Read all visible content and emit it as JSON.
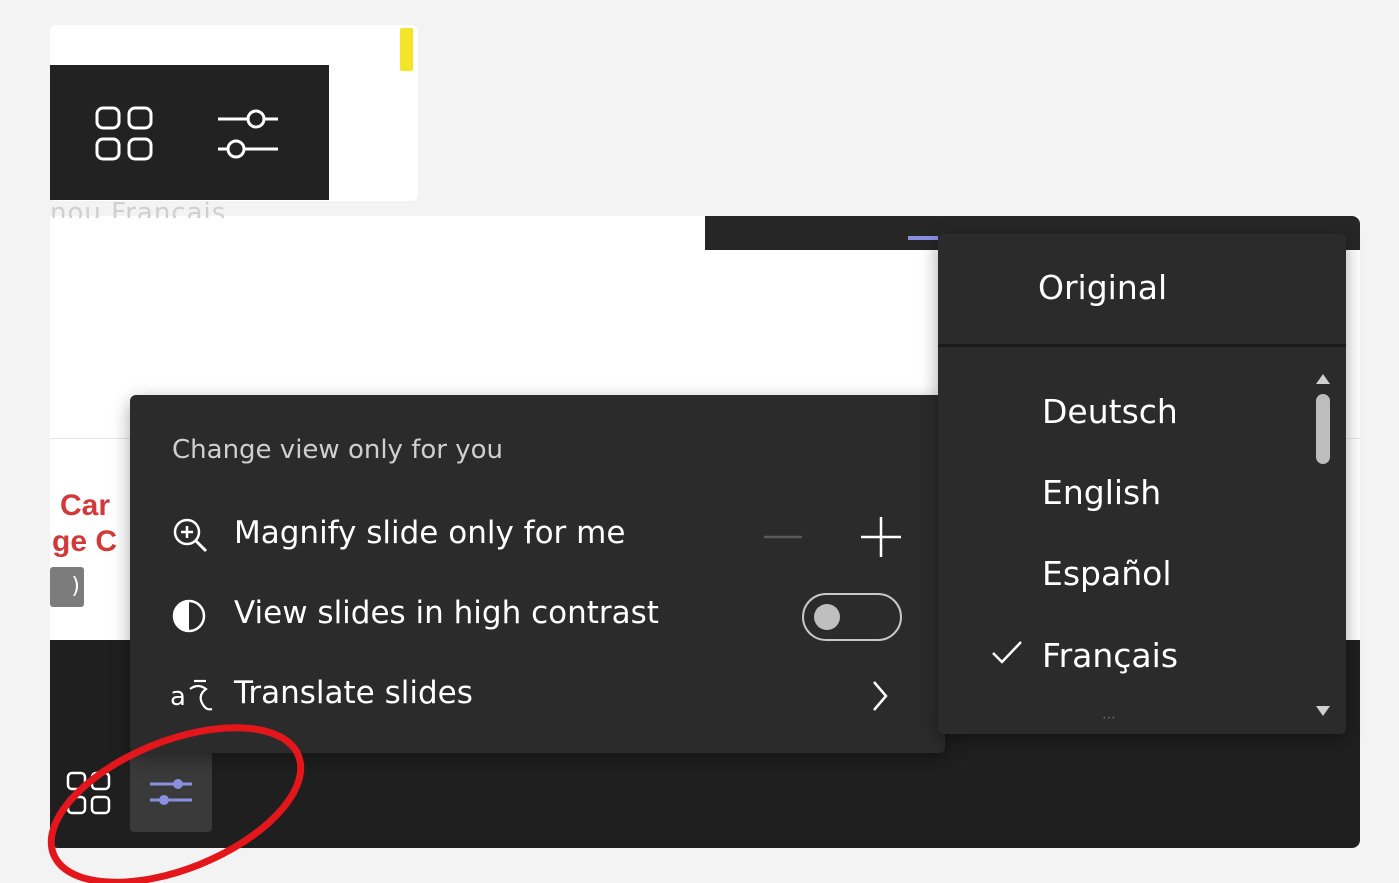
{
  "background_text_fragment": "nou Français",
  "slide": {
    "red_text_lines": [
      "Car",
      "ge C"
    ],
    "chip_text": ")"
  },
  "view_menu": {
    "heading": "Change view only for you",
    "magnify": {
      "label": "Magnify slide only for me",
      "icon": "zoom-in-icon",
      "decrease_icon": "minus-icon",
      "increase_icon": "plus-icon"
    },
    "contrast": {
      "label": "View slides in high contrast",
      "icon": "contrast-icon",
      "toggle_on": false
    },
    "translate": {
      "label": "Translate slides",
      "icon": "translate-icon",
      "chevron_icon": "chevron-right-icon"
    }
  },
  "language_menu": {
    "original": "Original",
    "languages": [
      {
        "label": "Deutsch",
        "selected": false
      },
      {
        "label": "English",
        "selected": false
      },
      {
        "label": "Español",
        "selected": false
      },
      {
        "label": "Français",
        "selected": true
      }
    ]
  },
  "toolbar_icons": [
    "grid-icon",
    "settings-sliders-icon"
  ],
  "colors": {
    "menu_bg": "#2b2b2b",
    "bar_bg": "#1f1f1f",
    "accent_purple": "#8a8fe0",
    "annotation_red": "#e3161b",
    "highlight_yellow": "#f5e52a"
  }
}
